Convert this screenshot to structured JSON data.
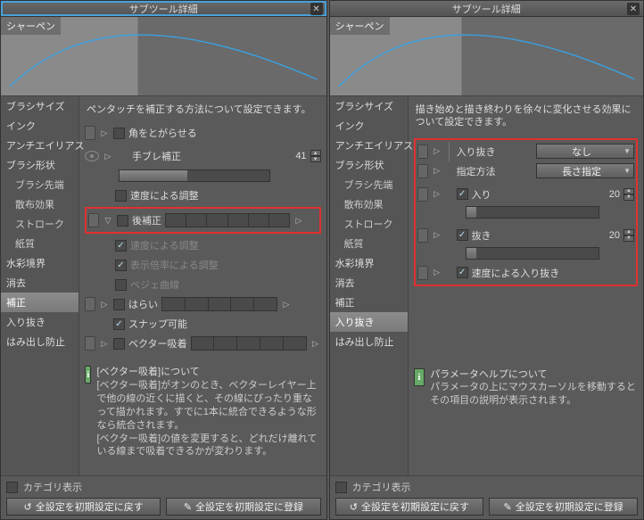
{
  "left": {
    "title": "サブツール詳細",
    "preview_label": "シャーペン",
    "sidebar": [
      {
        "label": "ブラシサイズ"
      },
      {
        "label": "インク"
      },
      {
        "label": "アンチエイリアス"
      },
      {
        "label": "ブラシ形状"
      },
      {
        "label": "ブラシ先端",
        "indent": true
      },
      {
        "label": "散布効果",
        "indent": true
      },
      {
        "label": "ストローク",
        "indent": true
      },
      {
        "label": "紙質",
        "indent": true
      },
      {
        "label": "水彩境界"
      },
      {
        "label": "消去"
      },
      {
        "label": "補正",
        "selected": true
      },
      {
        "label": "入り抜き"
      },
      {
        "label": "はみ出し防止"
      }
    ],
    "desc": "ペンタッチを補正する方法について設定できます。",
    "rows": {
      "r1": "角をとがらせる",
      "r2": "手ブレ補正",
      "r2val": "41",
      "r3": "速度による調整",
      "r4": "後補正",
      "r5": "速度による調整",
      "r6": "表示倍率による調整",
      "r7": "ベジェ曲線",
      "r8": "はらい",
      "r9": "スナップ可能",
      "r10": "ベクター吸着"
    },
    "info_title": "[ベクター吸着]について",
    "info_body": "[ベクター吸着]がオンのとき、ベクターレイヤー上で他の線の近くに描くと、その線にぴったり重なって描かれます。すでに1本に統合できるような形なら統合されます。\n[ベクター吸着]の値を変更すると、どれだけ離れている線まで吸着できるかが変わります。",
    "category": "カテゴリ表示",
    "btn_reset": "全設定を初期設定に戻す",
    "btn_save": "全設定を初期設定に登録"
  },
  "right": {
    "title": "サブツール詳細",
    "preview_label": "シャーペン",
    "sidebar": [
      {
        "label": "ブラシサイズ"
      },
      {
        "label": "インク"
      },
      {
        "label": "アンチエイリアス"
      },
      {
        "label": "ブラシ形状"
      },
      {
        "label": "ブラシ先端",
        "indent": true
      },
      {
        "label": "散布効果",
        "indent": true
      },
      {
        "label": "ストローク",
        "indent": true
      },
      {
        "label": "紙質",
        "indent": true
      },
      {
        "label": "水彩境界"
      },
      {
        "label": "消去"
      },
      {
        "label": "補正"
      },
      {
        "label": "入り抜き",
        "selected": true
      },
      {
        "label": "はみ出し防止"
      }
    ],
    "desc": "描き始めと描き終わりを徐々に変化させる効果について設定できます。",
    "rows": {
      "r1": "入り抜き",
      "dd1": "なし",
      "r2": "指定方法",
      "dd2": "長さ指定",
      "r3": "入り",
      "r3val": "20",
      "r4": "抜き",
      "r4val": "20",
      "r5": "速度による入り抜き"
    },
    "info_title": "パラメータヘルプについて",
    "info_body": "パラメータの上にマウスカーソルを移動するとその項目の説明が表示されます。",
    "category": "カテゴリ表示",
    "btn_reset": "全設定を初期設定に戻す",
    "btn_save": "全設定を初期設定に登録"
  }
}
